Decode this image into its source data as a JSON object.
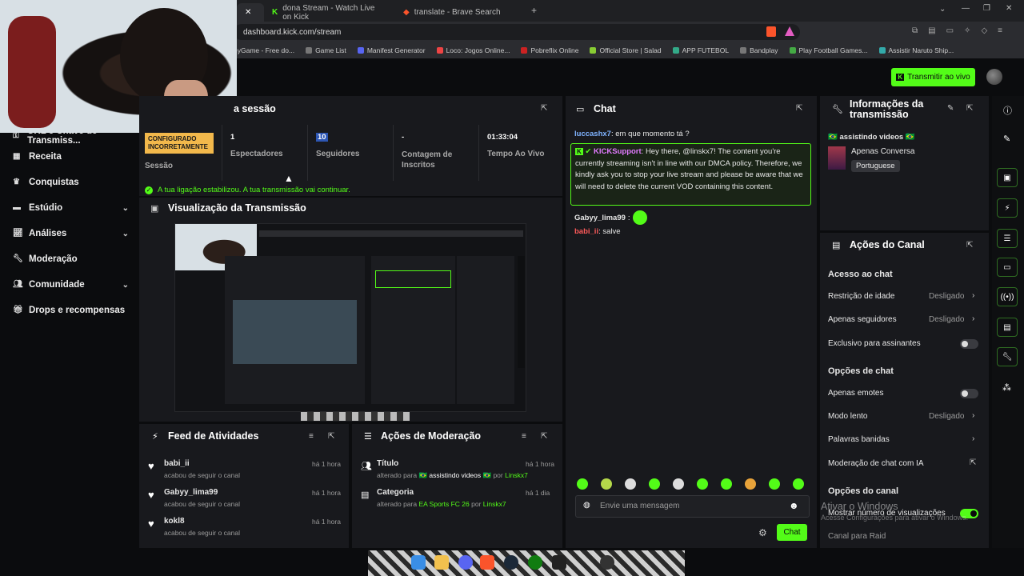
{
  "browser": {
    "tabs": [
      {
        "label": "dona Stream - Watch Live on Kick",
        "icon": "kick-icon"
      },
      {
        "label": "translate - Brave Search",
        "icon": "brave-icon"
      }
    ],
    "url": "dashboard.kick.com/stream",
    "bookmarks": [
      "nyGame - Free do...",
      "Game List",
      "Manifest Generator",
      "Loco: Jogos Online...",
      "Pobreflix Online",
      "Official Store | Salad",
      "APP FUTEBOL",
      "Bandplay",
      "Play Football Games...",
      "Assistir Naruto Ship..."
    ]
  },
  "header": {
    "go_live": "Transmitir ao vivo"
  },
  "sidebar": {
    "items": [
      {
        "label": "URL e Chave de Transmiss...",
        "icon": "key-icon",
        "chevron": false
      },
      {
        "label": "Receita",
        "icon": "revenue-icon",
        "chevron": false
      },
      {
        "label": "Conquistas",
        "icon": "trophy-icon",
        "chevron": false
      },
      {
        "label": "Estúdio",
        "icon": "studio-icon",
        "chevron": true
      },
      {
        "label": "Análises",
        "icon": "analytics-icon",
        "chevron": true
      },
      {
        "label": "Moderação",
        "icon": "wrench-icon",
        "chevron": false
      },
      {
        "label": "Comunidade",
        "icon": "community-icon",
        "chevron": true
      },
      {
        "label": "Drops e recompensas",
        "icon": "gift-icon",
        "chevron": false
      }
    ]
  },
  "session": {
    "title": "a sessão",
    "badge": "CONFIGURADO INCORRETAMENTE",
    "stats": [
      {
        "value": "",
        "label": "Sessão"
      },
      {
        "value": "1",
        "label": "Espectadores"
      },
      {
        "value": "10",
        "label": "Seguidores"
      },
      {
        "value": "-",
        "label": "Contagem de Inscritos"
      },
      {
        "value": "01:33:04",
        "label": "Tempo Ao Vivo"
      }
    ],
    "notice": "A tua ligação estabilizou. A tua transmissão vai continuar."
  },
  "preview": {
    "title": "Visualização da Transmissão"
  },
  "activity": {
    "title": "Feed de Atividades",
    "items": [
      {
        "user": "babi_ii",
        "action": "acabou de seguir o canal",
        "time": "há 1 hora"
      },
      {
        "user": "Gabyy_lima99",
        "action": "acabou de seguir o canal",
        "time": "há 1 hora"
      },
      {
        "user": "kokl8",
        "action": "acabou de seguir o canal",
        "time": "há 1 hora"
      }
    ]
  },
  "moderation": {
    "title": "Ações de Moderação",
    "items": [
      {
        "title": "Título",
        "pre": "alterado para ",
        "value": "🇧🇷 assistindo videos 🇧🇷",
        "by_pre": " por ",
        "by": "Linskx7",
        "time": "há 1 hora"
      },
      {
        "title": "Categoria",
        "pre": "alterado para ",
        "value": "EA Sports FC 26",
        "by_pre": " por ",
        "by": "Linskx7",
        "time": "há 1 dia"
      }
    ]
  },
  "chat": {
    "title": "Chat",
    "messages": [
      {
        "user": "luccashx7",
        "color": "#7fb3ff",
        "text": ": em que momento tá ?"
      },
      {
        "user": "KICKSupport",
        "color": "#e27bff",
        "text": ": Hey there, @linskx7! The content you're currently streaming isn't in line with our DMCA policy. Therefore, we kindly ask you to stop your live stream and please be aware that we will need to delete the current VOD containing this content."
      },
      {
        "user": "Gabyy_lima99",
        "color": "#e6e6e6",
        "text": ":"
      },
      {
        "user": "babi_ii",
        "color": "#ff5a5a",
        "text": ": salve"
      }
    ],
    "placeholder": "Envie uma mensagem",
    "send": "Chat"
  },
  "info": {
    "title": "Informações da transmissão",
    "stream_title": "🇧🇷 assistindo videos 🇧🇷",
    "category": "Apenas Conversa",
    "language": "Portuguese"
  },
  "channel_actions": {
    "title": "Ações do Canal",
    "chat_access": "Acesso ao chat",
    "age_restriction": "Restrição de idade",
    "age_restriction_value": "Desligado",
    "followers_only": "Apenas seguidores",
    "followers_only_value": "Desligado",
    "subscribers_only": "Exclusivo para assinantes",
    "chat_options": "Opções de chat",
    "emotes_only": "Apenas emotes",
    "slow_mode": "Modo lento",
    "slow_mode_value": "Desligado",
    "banned_words": "Palavras banidas",
    "ai_moderation": "Moderação de chat com IA",
    "channel_options": "Opções do canal",
    "show_views": "Mostrar número de visualizações",
    "raid": "Canal para Raid"
  },
  "watermark": {
    "line1": "Ativar o Windows",
    "line2": "Acesse Configurações para ativar o Windows."
  }
}
